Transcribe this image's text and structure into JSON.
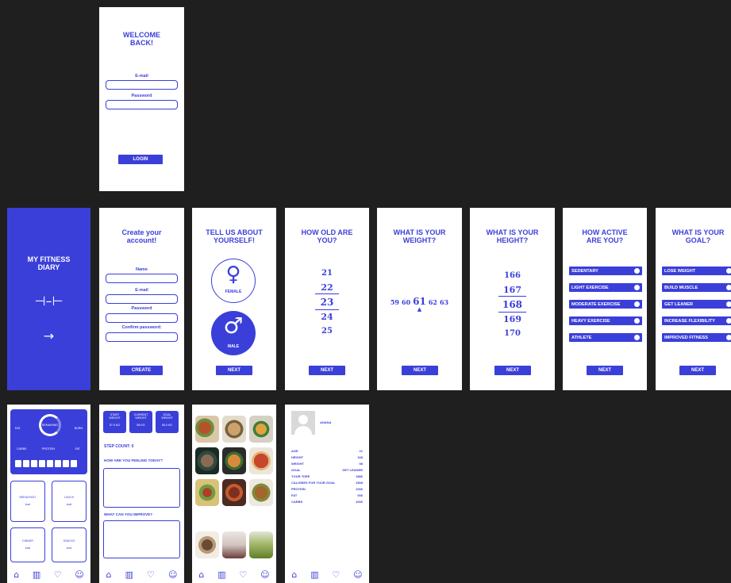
{
  "login": {
    "title": "WELCOME\nBACK!",
    "email_label": "E-mail",
    "password_label": "Password",
    "button": "LOGIN"
  },
  "splash": {
    "title": "MY FITNESS\nDIARY",
    "logo": "dumbbell-icon",
    "arrow": "→"
  },
  "register": {
    "title": "Create your\naccount!",
    "name_label": "Name",
    "email_label": "E-mail",
    "password_label": "Password",
    "confirm_label": "Confirm password:",
    "button": "CREATE"
  },
  "gender": {
    "title": "TELL US ABOUT\nYOURSELF!",
    "female": "FEMALE",
    "male": "MALE",
    "female_symbol": "♀",
    "male_symbol": "♂",
    "button": "NEXT"
  },
  "age": {
    "title": "HOW OLD ARE\nYOU?",
    "values": [
      "21",
      "22",
      "23",
      "24",
      "25"
    ],
    "button": "NEXT"
  },
  "weight": {
    "title": "WHAT IS YOUR\nWEIGHT?",
    "values": [
      "59",
      "60",
      "61",
      "62",
      "63"
    ],
    "button": "NEXT"
  },
  "height": {
    "title": "WHAT IS YOUR\nHEIGHT?",
    "values": [
      "166",
      "167",
      "168",
      "169",
      "170"
    ],
    "button": "NEXT"
  },
  "activity": {
    "title": "HOW ACTIVE\nARE YOU?",
    "options": [
      "SEDENTARY",
      "LIGHT EXERCISE",
      "MODERATE EXERCISE",
      "HEAVY EXERCISE",
      "ATHLETE"
    ],
    "button": "NEXT"
  },
  "goal": {
    "title": "WHAT IS YOUR\nGOAL?",
    "options": [
      "LOSE WEIGHT",
      "BUILD MUSCLE",
      "GET LEANER",
      "INCREASE FLEXIBILITY",
      "IMPROVED FITNESS"
    ],
    "button": "NEXT"
  },
  "dashboard": {
    "left_top": "EAT",
    "ring_center": "REMAINING",
    "right_top": "BURN",
    "carbs": "CARBS",
    "protein": "PROTEIN",
    "fat": "FAT",
    "meals": [
      "BREAKFAST",
      "LUNCH",
      "DINNER",
      "SNACKS"
    ],
    "meal_sub": "kcal"
  },
  "progress": {
    "start": "START WEIGHT",
    "current": "CURRENT WEIGHT",
    "goal": "GOAL WEIGHT",
    "start_val": "57.5 KG",
    "current_val": "58 KG",
    "goal_val": "55.0 KG",
    "steps": "STEP COUNT: 0",
    "feeling": "HOW ARE YOU FEELING TODAY?",
    "improve": "WHAT CAN YOU IMPROVE?"
  },
  "profile": {
    "name": "ANANA",
    "rows": [
      {
        "k": "AGE",
        "v": "21"
      },
      {
        "k": "HEIGHT",
        "v": "168"
      },
      {
        "k": "WEIGHT",
        "v": "58"
      },
      {
        "k": "GOAL",
        "v": "GET LEANER"
      },
      {
        "k": "YOUR TDEE",
        "v": "1886"
      },
      {
        "k": "CALORIES FOR YOUR GOAL",
        "v": "1508"
      },
      {
        "k": "PROTEIN",
        "v": "1006"
      },
      {
        "k": "FAT",
        "v": "006"
      },
      {
        "k": "CARBS",
        "v": "1006"
      }
    ]
  },
  "nav": {
    "home": "⌂",
    "stats": "▥",
    "food": "♡",
    "profile": "☺"
  },
  "colors": {
    "accent": "#3b3fd9",
    "background": "#1f1f1f"
  }
}
